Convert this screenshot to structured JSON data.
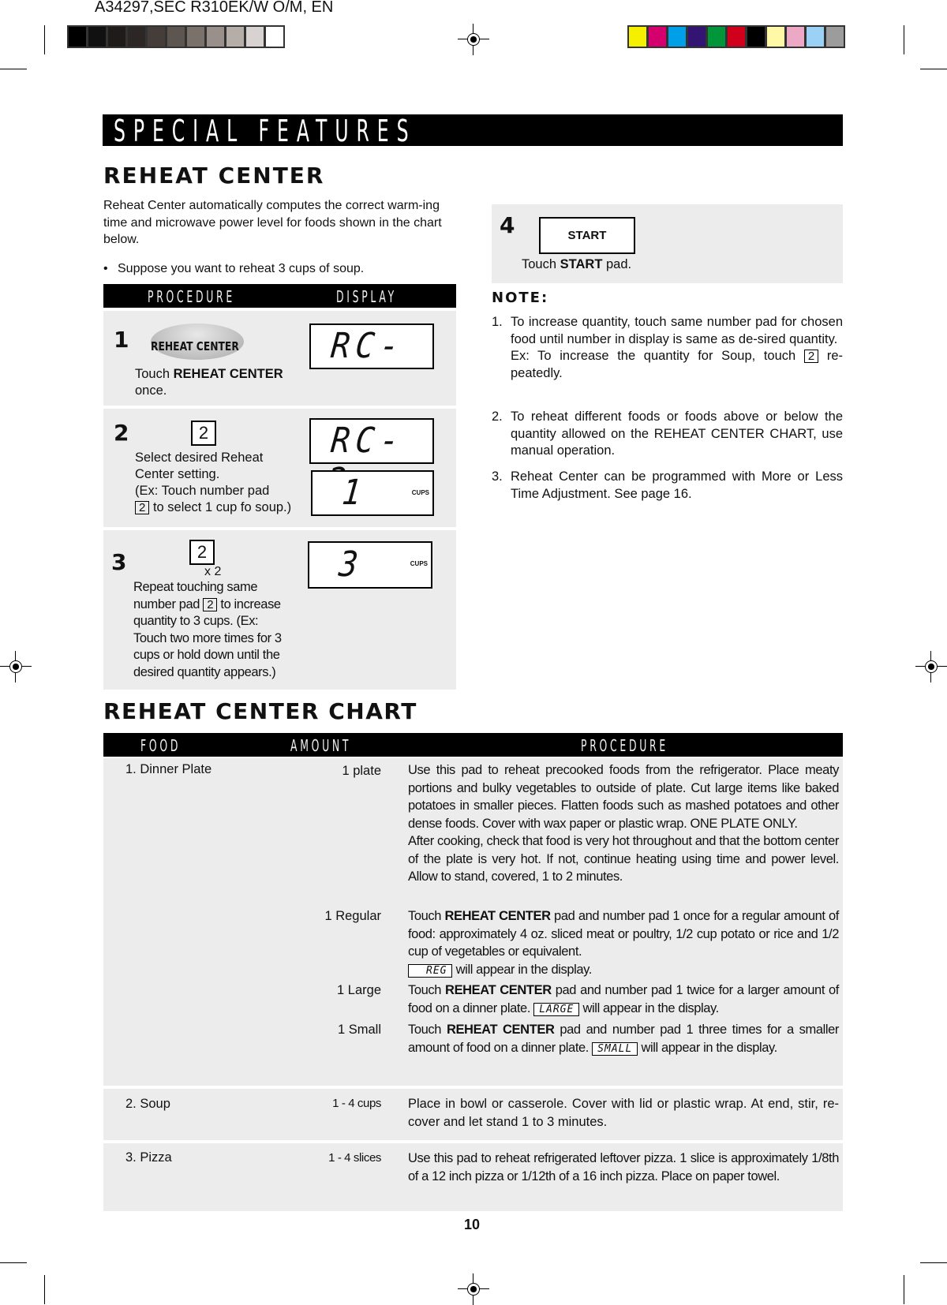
{
  "print_header": {
    "job_title": "A34297,SEC R310EK/W O/M, EN",
    "gray_swatches": [
      "#000000",
      "#111111",
      "#1f1b19",
      "#2c2624",
      "#453d39",
      "#5d5550",
      "#7b716b",
      "#9a908b",
      "#b5ada8",
      "#d8d3d0",
      "#ffffff"
    ],
    "color_swatches": [
      "#f5ef00",
      "#d3006e",
      "#00a0e8",
      "#341473",
      "#009639",
      "#d0001d",
      "#000000",
      "#fff8a6",
      "#eca8c5",
      "#9cd1f6",
      "#9c9c9c"
    ]
  },
  "banner": {
    "title": "SPECIAL FEATURES"
  },
  "reheat_center": {
    "heading": "REHEAT CENTER",
    "intro": "Reheat Center automatically computes the correct warm-ing time and microwave power level for foods shown in the chart below.",
    "bullet": "Suppose you want to reheat 3 cups of soup.",
    "table_headers": {
      "procedure": "PROCEDURE",
      "display": "DISPLAY"
    },
    "steps": [
      {
        "number": "1",
        "pad_label": "REHEAT CENTER",
        "text_pre": "Touch ",
        "text_bold": "REHEAT CENTER",
        "text_post": "once.",
        "display": "RC-"
      },
      {
        "number": "2",
        "pad_label": "2",
        "text_lines": [
          "Select desired Reheat",
          "Center setting.",
          "(Ex: Touch number pad"
        ],
        "text_pad": "2",
        "text_tail": "to select 1 cup fo soup.)",
        "display": "RC-2",
        "display2": "1",
        "display2_unit": "CUPS"
      },
      {
        "number": "3",
        "pad_label": "2",
        "multiplier": "x 2",
        "text_l1": "Repeat touching same",
        "text_l2_pre": "number pad",
        "text_pad": "2",
        "text_l2_post": "to increase",
        "text_rest": [
          "quantity to 3 cups. (Ex:",
          "Touch two more times for 3",
          "cups or hold down until the",
          "desired quantity appears.)"
        ],
        "display": "3",
        "display_unit": "CUPS"
      },
      {
        "number": "4",
        "pad_label": "START",
        "text_pre": "Touch ",
        "text_bold": "START",
        "text_post": " pad."
      }
    ]
  },
  "notes": {
    "heading": "NOTE:",
    "items": [
      {
        "n": "1.",
        "text": "To increase quantity, touch same number pad for chosen food until number in display is same as de-sired quantity.",
        "ex_pre": "Ex: To increase the quantity for Soup, touch",
        "ex_pad": "2",
        "ex_post": "re-peatedly."
      },
      {
        "n": "2.",
        "text": "To reheat different foods or foods above or below the quantity allowed on the REHEAT CENTER CHART, use manual operation."
      },
      {
        "n": "3.",
        "text": "Reheat Center can be programmed with More or Less Time Adjustment. See page 16."
      }
    ]
  },
  "chart": {
    "heading": "REHEAT CENTER CHART",
    "headers": {
      "food": "FOOD",
      "amount": "AMOUNT",
      "procedure": "PROCEDURE"
    },
    "rows": [
      {
        "food": "1.  Dinner Plate",
        "entries": [
          {
            "amount": "1 plate",
            "p1": "Use this pad to reheat precooked foods from the refrigerator. Place meaty portions and bulky vegetables to outside of plate. Cut large items like baked potatoes in smaller pieces. Flatten foods such as mashed potatoes and other dense foods. Cover with wax paper or plastic wrap. ONE PLATE ONLY.",
            "p2": "After cooking, check that food is very hot throughout and that the bottom center of the plate is very hot. If not, continue heating using time and power level. Allow to stand, covered, 1 to 2 minutes."
          },
          {
            "amount": "1 Regular",
            "pre": "Touch ",
            "bold": "REHEAT CENTER",
            "post": " pad and number pad 1 once for a regular amount of food: approximately 4 oz. sliced meat or poultry, 1/2 cup potato or rice and 1/2 cup of vegetables or equivalent.",
            "lcd": "REG",
            "lcd_post": " will appear in the display."
          },
          {
            "amount": "1 Large",
            "pre": "Touch ",
            "bold": "REHEAT CENTER",
            "post": " pad and number pad 1 twice for a larger amount of food on a dinner plate. ",
            "lcd": "LARGE",
            "lcd_post": " will appear in the display."
          },
          {
            "amount": "1 Small",
            "pre": "Touch ",
            "bold": "REHEAT CENTER",
            "post": " pad and number pad 1 three times for a smaller amount of food on a dinner plate. ",
            "lcd": "SMALL",
            "lcd_post": " will  appear  in the display."
          }
        ]
      },
      {
        "food": "2.  Soup",
        "amount": "1 - 4 cups",
        "procedure": "Place in bowl or casserole. Cover with lid or plastic wrap. At end, stir, re-cover and let stand 1 to 3 minutes."
      },
      {
        "food": "3.  Pizza",
        "amount": "1 - 4 slices",
        "procedure": "Use this pad to reheat refrigerated leftover pizza. 1 slice is approximately 1/8th of a 12 inch pizza or 1/12th of a 16 inch pizza. Place on paper towel."
      }
    ]
  },
  "footer": {
    "page_number": "10"
  }
}
